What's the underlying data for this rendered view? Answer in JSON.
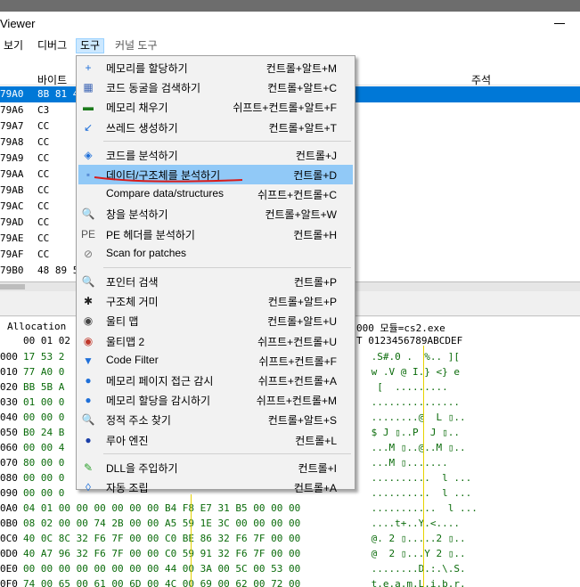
{
  "window": {
    "title": "Viewer"
  },
  "menubar": [
    {
      "label": "보기"
    },
    {
      "label": "디버그"
    },
    {
      "label": "도구"
    },
    {
      "label": "커널 도구"
    }
  ],
  "disasm": {
    "headers": {
      "bytes": "바이트",
      "comment": "주석"
    },
    "rows": [
      {
        "addr": "79A0",
        "bytes": "8B 81 4"
      },
      {
        "addr": "79A6",
        "bytes": "C3"
      },
      {
        "addr": "79A7",
        "bytes": "CC"
      },
      {
        "addr": "79A8",
        "bytes": "CC"
      },
      {
        "addr": "79A9",
        "bytes": "CC"
      },
      {
        "addr": "79AA",
        "bytes": "CC"
      },
      {
        "addr": "79AB",
        "bytes": "CC"
      },
      {
        "addr": "79AC",
        "bytes": "CC"
      },
      {
        "addr": "79AD",
        "bytes": "CC"
      },
      {
        "addr": "79AE",
        "bytes": "CC"
      },
      {
        "addr": "79AF",
        "bytes": "CC"
      },
      {
        "addr": "79B0",
        "bytes": "48 89 5"
      }
    ]
  },
  "hexview": {
    "header_left": "Allocation",
    "header_right": "000 모듈=cs2.exe",
    "col_header_left": "00 01 02",
    "col_header_right": "T 0123456789ABCDEF",
    "rows": [
      {
        "addr": "000",
        "bytes": "17 53 2",
        "ascii": " .S#.0 .  %.. ]["
      },
      {
        "addr": "010",
        "bytes": "77 A0 0",
        "ascii": " w .V @ I.} <} e"
      },
      {
        "addr": "020",
        "bytes": "BB 5B A",
        "ascii": "  [  ........."
      },
      {
        "addr": "030",
        "bytes": "01 00 0",
        "ascii": " ..............."
      },
      {
        "addr": "040",
        "bytes": "00 00 0",
        "ascii": " ........@  L ▯.."
      },
      {
        "addr": "050",
        "bytes": "B0 24 B",
        "ascii": " $ J ▯..P  J ▯.."
      },
      {
        "addr": "060",
        "bytes": "00 00 4",
        "ascii": " ...M ▯..@..M ▯.."
      },
      {
        "addr": "070",
        "bytes": "80 00 0",
        "ascii": " ...M ▯......."
      },
      {
        "addr": "080",
        "bytes": "00 00 0",
        "ascii": " ..........  l ..."
      },
      {
        "addr": "090",
        "bytes": "00 00 0",
        "ascii": " ..........  l ..."
      },
      {
        "addr": "0A0",
        "bytes": "04 01 00 00 00 00 00 00 B4 F8 E7 31 B5 00 00 00",
        "ascii": " ...........  l ..."
      },
      {
        "addr": "0B0",
        "bytes": "08 02 00 00 74 2B 00 00 A5 59 1E 3C 00 00 00 00",
        "ascii": " ....t+..Y.<...."
      },
      {
        "addr": "0C0",
        "bytes": "40 0C 8C 32 F6 7F 00 00 C0 BE 86 32 F6 7F 00 00",
        "ascii": " @. 2 ▯.....2 ▯.."
      },
      {
        "addr": "0D0",
        "bytes": "40 A7 96 32 F6 7F 00 00 C0 59 91 32 F6 7F 00 00",
        "ascii": " @  2 ▯...Y 2 ▯.."
      },
      {
        "addr": "0E0",
        "bytes": "00 00 00 00 00 00 00 00 44 00 3A 00 5C 00 53 00",
        "ascii": " ........D.:.\\.S."
      },
      {
        "addr": "0F0",
        "bytes": "74 00 65 00 61 00 6D 00 4C 00 69 00 62 00 72 00",
        "ascii": " t.e.a.m.L.i.b.r."
      }
    ]
  },
  "tools_menu": {
    "items": [
      {
        "icon": "allocate-memory-icon",
        "glyph": "+",
        "color": "#1e6fd9",
        "label": "메모리를 할당하기",
        "shortcut": "컨트롤+알트+M"
      },
      {
        "icon": "code-cave-icon",
        "glyph": "▦",
        "color": "#3c64b4",
        "label": "코드 동굴을 검색하기",
        "shortcut": "컨트롤+알트+C"
      },
      {
        "icon": "fill-memory-icon",
        "glyph": "▬",
        "color": "#1c7a1c",
        "label": "메모리 채우기",
        "shortcut": "쉬프트+컨트롤+알트+F"
      },
      {
        "icon": "create-thread-icon",
        "glyph": "↙",
        "color": "#1e6fd9",
        "label": "쓰레드 생성하기",
        "shortcut": "컨트롤+알트+T"
      },
      {
        "sep": true
      },
      {
        "icon": "dissect-code-icon",
        "glyph": "◈",
        "color": "#1e6fd9",
        "label": "코드를 분석하기",
        "shortcut": "컨트롤+J"
      },
      {
        "icon": "dissect-data-icon",
        "glyph": "▪",
        "color": "#5a8fd6",
        "label": "데이터/구조체를 분석하기",
        "shortcut": "컨트롤+D",
        "highlighted": true
      },
      {
        "icon": "compare-data-icon",
        "glyph": "",
        "color": "#5a8fd6",
        "label": "Compare data/structures",
        "shortcut": "쉬프트+컨트롤+C"
      },
      {
        "icon": "dissect-window-icon",
        "glyph": "🔍",
        "color": "#1e6fd9",
        "label": "창을 분석하기",
        "shortcut": "컨트롤+알트+W"
      },
      {
        "icon": "dissect-pe-icon",
        "glyph": "PE",
        "color": "#555555",
        "label": "PE 헤더를 분석하기",
        "shortcut": "컨트롤+H"
      },
      {
        "icon": "scan-patches-icon",
        "glyph": "⊘",
        "color": "#777777",
        "label": "Scan for patches",
        "shortcut": ""
      },
      {
        "sep": true
      },
      {
        "icon": "pointer-scan-icon",
        "glyph": "🔍",
        "color": "#1e6fd9",
        "label": "포인터 검색",
        "shortcut": "컨트롤+P"
      },
      {
        "icon": "structure-spider-icon",
        "glyph": "✱",
        "color": "#222222",
        "label": "구조체 거미",
        "shortcut": "컨트롤+알트+P"
      },
      {
        "icon": "ultimap-icon",
        "glyph": "◉",
        "color": "#444444",
        "label": "울티 맵",
        "shortcut": "컨트롤+알트+U"
      },
      {
        "icon": "ultimap2-icon",
        "glyph": "◉",
        "color": "#c0392b",
        "label": "울티맵 2",
        "shortcut": "쉬프트+컨트롤+U"
      },
      {
        "icon": "code-filter-icon",
        "glyph": "▼",
        "color": "#1e6fd9",
        "label": "Code Filter",
        "shortcut": "쉬프트+컨트롤+F"
      },
      {
        "icon": "watch-page-access-icon",
        "glyph": "●",
        "color": "#1e6fd9",
        "label": "메모리 페이지 접근 감시",
        "shortcut": "쉬프트+컨트롤+A"
      },
      {
        "icon": "watch-allocations-icon",
        "glyph": "●",
        "color": "#1e6fd9",
        "label": "메모리 할당을 감시하기",
        "shortcut": "쉬프트+컨트롤+M"
      },
      {
        "icon": "find-static-address-icon",
        "glyph": "🔍",
        "color": "#1e6fd9",
        "label": "정적 주소 찾기",
        "shortcut": "컨트롤+알트+S"
      },
      {
        "icon": "lua-engine-icon",
        "glyph": "●",
        "color": "#1a3ea8",
        "label": "루아 엔진",
        "shortcut": "컨트롤+L"
      },
      {
        "sep": true
      },
      {
        "icon": "inject-dll-icon",
        "glyph": "✎",
        "color": "#2aa02a",
        "label": "DLL을 주입하기",
        "shortcut": "컨트롤+I"
      },
      {
        "icon": "auto-assemble-icon",
        "glyph": "◊",
        "color": "#1e6fd9",
        "label": "자동 조립",
        "shortcut": "컨트롤+A"
      }
    ]
  }
}
